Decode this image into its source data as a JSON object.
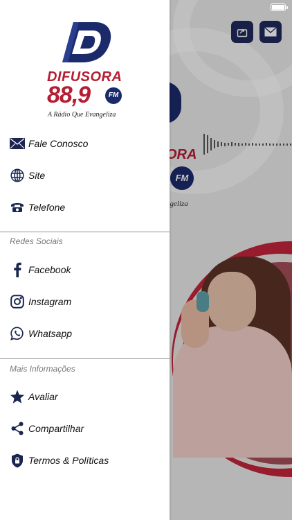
{
  "background": {
    "logo_fragment_name": "ORA",
    "logo_fragment_fm": "FM",
    "logo_fragment_tagline": "ngeliza",
    "top_buttons": {
      "share_icon": "share-icon",
      "mail_icon": "mail-icon"
    }
  },
  "drawer": {
    "logo": {
      "name": "DIFUSORA",
      "frequency": "88,9",
      "band": "FM",
      "tagline": "A Rádio Que Evangeliza"
    },
    "items": [
      {
        "label": "Fale Conosco",
        "icon": "mail-icon"
      },
      {
        "label": "Site",
        "icon": "globe-icon"
      },
      {
        "label": "Telefone",
        "icon": "phone-icon"
      }
    ],
    "sections": [
      {
        "title": "Redes Sociais",
        "items": [
          {
            "label": "Facebook",
            "icon": "facebook-icon"
          },
          {
            "label": "Instagram",
            "icon": "instagram-icon"
          },
          {
            "label": "Whatsapp",
            "icon": "whatsapp-icon"
          }
        ]
      },
      {
        "title": "Mais Informações",
        "items": [
          {
            "label": "Avaliar",
            "icon": "star-icon"
          },
          {
            "label": "Compartilhar",
            "icon": "share-icon"
          },
          {
            "label": "Termos & Políticas",
            "icon": "shield-icon"
          }
        ]
      }
    ]
  },
  "colors": {
    "brand_red": "#b51d33",
    "brand_navy": "#1b2a6b",
    "icon": "#1a2550"
  }
}
